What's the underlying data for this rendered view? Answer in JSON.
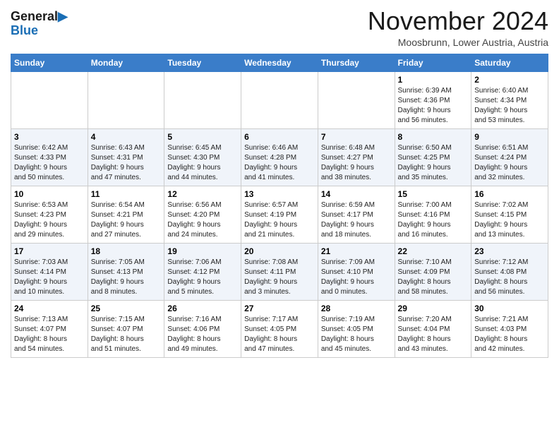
{
  "header": {
    "logo_line1": "General",
    "logo_line2": "Blue",
    "month_title": "November 2024",
    "location": "Moosbrunn, Lower Austria, Austria"
  },
  "weekdays": [
    "Sunday",
    "Monday",
    "Tuesday",
    "Wednesday",
    "Thursday",
    "Friday",
    "Saturday"
  ],
  "weeks": [
    [
      {
        "day": "",
        "info": ""
      },
      {
        "day": "",
        "info": ""
      },
      {
        "day": "",
        "info": ""
      },
      {
        "day": "",
        "info": ""
      },
      {
        "day": "",
        "info": ""
      },
      {
        "day": "1",
        "info": "Sunrise: 6:39 AM\nSunset: 4:36 PM\nDaylight: 9 hours\nand 56 minutes."
      },
      {
        "day": "2",
        "info": "Sunrise: 6:40 AM\nSunset: 4:34 PM\nDaylight: 9 hours\nand 53 minutes."
      }
    ],
    [
      {
        "day": "3",
        "info": "Sunrise: 6:42 AM\nSunset: 4:33 PM\nDaylight: 9 hours\nand 50 minutes."
      },
      {
        "day": "4",
        "info": "Sunrise: 6:43 AM\nSunset: 4:31 PM\nDaylight: 9 hours\nand 47 minutes."
      },
      {
        "day": "5",
        "info": "Sunrise: 6:45 AM\nSunset: 4:30 PM\nDaylight: 9 hours\nand 44 minutes."
      },
      {
        "day": "6",
        "info": "Sunrise: 6:46 AM\nSunset: 4:28 PM\nDaylight: 9 hours\nand 41 minutes."
      },
      {
        "day": "7",
        "info": "Sunrise: 6:48 AM\nSunset: 4:27 PM\nDaylight: 9 hours\nand 38 minutes."
      },
      {
        "day": "8",
        "info": "Sunrise: 6:50 AM\nSunset: 4:25 PM\nDaylight: 9 hours\nand 35 minutes."
      },
      {
        "day": "9",
        "info": "Sunrise: 6:51 AM\nSunset: 4:24 PM\nDaylight: 9 hours\nand 32 minutes."
      }
    ],
    [
      {
        "day": "10",
        "info": "Sunrise: 6:53 AM\nSunset: 4:23 PM\nDaylight: 9 hours\nand 29 minutes."
      },
      {
        "day": "11",
        "info": "Sunrise: 6:54 AM\nSunset: 4:21 PM\nDaylight: 9 hours\nand 27 minutes."
      },
      {
        "day": "12",
        "info": "Sunrise: 6:56 AM\nSunset: 4:20 PM\nDaylight: 9 hours\nand 24 minutes."
      },
      {
        "day": "13",
        "info": "Sunrise: 6:57 AM\nSunset: 4:19 PM\nDaylight: 9 hours\nand 21 minutes."
      },
      {
        "day": "14",
        "info": "Sunrise: 6:59 AM\nSunset: 4:17 PM\nDaylight: 9 hours\nand 18 minutes."
      },
      {
        "day": "15",
        "info": "Sunrise: 7:00 AM\nSunset: 4:16 PM\nDaylight: 9 hours\nand 16 minutes."
      },
      {
        "day": "16",
        "info": "Sunrise: 7:02 AM\nSunset: 4:15 PM\nDaylight: 9 hours\nand 13 minutes."
      }
    ],
    [
      {
        "day": "17",
        "info": "Sunrise: 7:03 AM\nSunset: 4:14 PM\nDaylight: 9 hours\nand 10 minutes."
      },
      {
        "day": "18",
        "info": "Sunrise: 7:05 AM\nSunset: 4:13 PM\nDaylight: 9 hours\nand 8 minutes."
      },
      {
        "day": "19",
        "info": "Sunrise: 7:06 AM\nSunset: 4:12 PM\nDaylight: 9 hours\nand 5 minutes."
      },
      {
        "day": "20",
        "info": "Sunrise: 7:08 AM\nSunset: 4:11 PM\nDaylight: 9 hours\nand 3 minutes."
      },
      {
        "day": "21",
        "info": "Sunrise: 7:09 AM\nSunset: 4:10 PM\nDaylight: 9 hours\nand 0 minutes."
      },
      {
        "day": "22",
        "info": "Sunrise: 7:10 AM\nSunset: 4:09 PM\nDaylight: 8 hours\nand 58 minutes."
      },
      {
        "day": "23",
        "info": "Sunrise: 7:12 AM\nSunset: 4:08 PM\nDaylight: 8 hours\nand 56 minutes."
      }
    ],
    [
      {
        "day": "24",
        "info": "Sunrise: 7:13 AM\nSunset: 4:07 PM\nDaylight: 8 hours\nand 54 minutes."
      },
      {
        "day": "25",
        "info": "Sunrise: 7:15 AM\nSunset: 4:07 PM\nDaylight: 8 hours\nand 51 minutes."
      },
      {
        "day": "26",
        "info": "Sunrise: 7:16 AM\nSunset: 4:06 PM\nDaylight: 8 hours\nand 49 minutes."
      },
      {
        "day": "27",
        "info": "Sunrise: 7:17 AM\nSunset: 4:05 PM\nDaylight: 8 hours\nand 47 minutes."
      },
      {
        "day": "28",
        "info": "Sunrise: 7:19 AM\nSunset: 4:05 PM\nDaylight: 8 hours\nand 45 minutes."
      },
      {
        "day": "29",
        "info": "Sunrise: 7:20 AM\nSunset: 4:04 PM\nDaylight: 8 hours\nand 43 minutes."
      },
      {
        "day": "30",
        "info": "Sunrise: 7:21 AM\nSunset: 4:03 PM\nDaylight: 8 hours\nand 42 minutes."
      }
    ]
  ]
}
